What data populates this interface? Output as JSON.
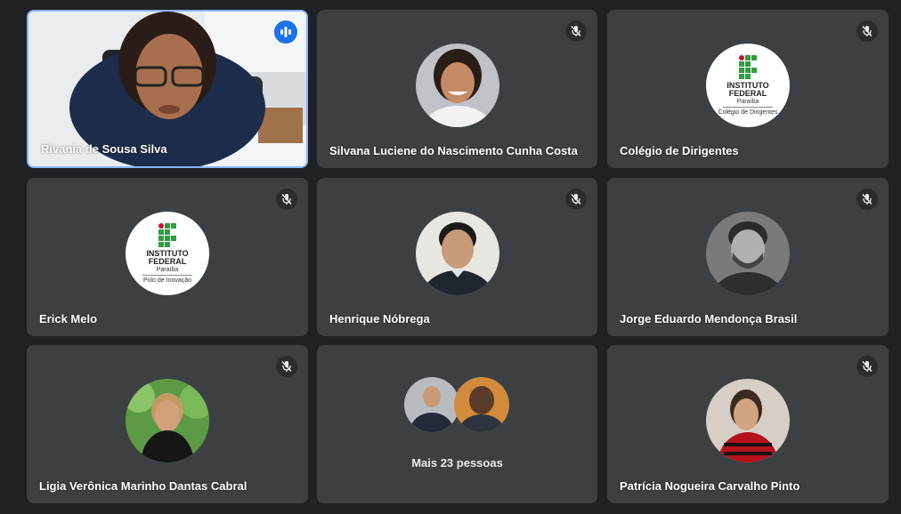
{
  "participants": [
    {
      "name": "Rivania de Sousa Silva",
      "state": "speaking"
    },
    {
      "name": "Silvana Luciene do Nascimento Cunha Costa",
      "state": "muted"
    },
    {
      "name": "Colégio de Dirigentes",
      "state": "muted",
      "logo": {
        "line1": "INSTITUTO",
        "line2": "FEDERAL",
        "line3": "Paraíba",
        "line4": "Colégio de Dirigentes"
      }
    },
    {
      "name": "Erick Melo",
      "state": "muted",
      "logo": {
        "line1": "INSTITUTO",
        "line2": "FEDERAL",
        "line3": "Paraíba",
        "line4": "Polo de Inovação"
      }
    },
    {
      "name": "Henrique Nóbrega",
      "state": "muted"
    },
    {
      "name": "Jorge Eduardo Mendonça Brasil",
      "state": "muted"
    },
    {
      "name": "Ligia Verônica Marinho Dantas Cabral",
      "state": "muted"
    },
    {
      "name": "Patrícia Nogueira Carvalho Pinto",
      "state": "muted"
    }
  ],
  "more": {
    "label": "Mais 23 pessoas"
  },
  "icons": {
    "muted": "mic-off-icon",
    "speaking": "audio-wave-icon"
  },
  "colors": {
    "background": "#202124",
    "tile": "#3c4043",
    "active_border": "#8ab4f8",
    "speaking": "#1a73e8"
  }
}
